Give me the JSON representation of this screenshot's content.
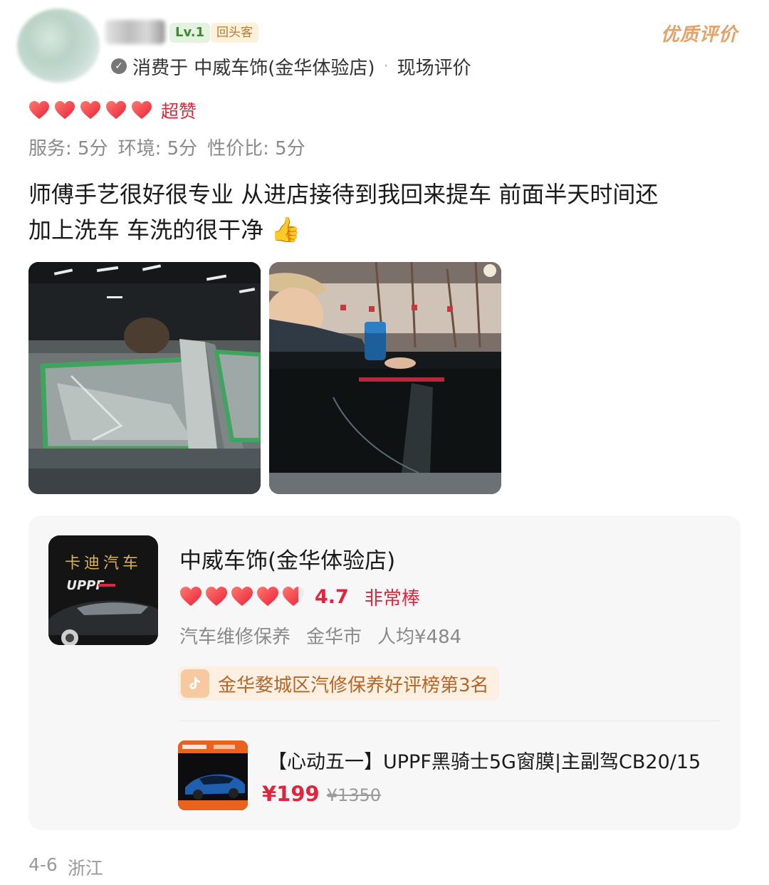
{
  "header": {
    "level_badge": "Lv.1",
    "return_badge": "回头客",
    "quality_tag": "优质评价",
    "consumed_at": "消费于 中威车饰(金华体验店)",
    "review_type": "现场评价",
    "separator": "·"
  },
  "rating": {
    "hearts_filled": 5,
    "label": "超赞",
    "scores": [
      "服务: 5分",
      "环境: 5分",
      "性价比: 5分"
    ]
  },
  "review": {
    "line1": "师傅手艺很好很专业 从进店接待到我回来提车 前面半天时间还",
    "line2": "加上洗车 车洗的很干净",
    "emoji": "👍"
  },
  "shop": {
    "name": "中威车饰(金华体验店)",
    "score": "4.7",
    "score_word": "非常棒",
    "hearts_value": 4.7,
    "category": "汽车维修保养",
    "city": "金华市",
    "avg_price": "人均¥484",
    "rank": "金华婺城区汽修保养好评榜第3名",
    "thumb_sign": "卡迪汽车",
    "thumb_brand": "UPPF"
  },
  "deal": {
    "title": "【心动五一】UPPF黑骑士5G窗膜|主副驾CB20/15",
    "price": "¥199",
    "original_price": "¥1350"
  },
  "footer": {
    "date": "4-6",
    "location": "浙江"
  },
  "colors": {
    "accent_red": "#e0263f",
    "quality_orange": "#e2a269",
    "rank_brown": "#b26627"
  }
}
